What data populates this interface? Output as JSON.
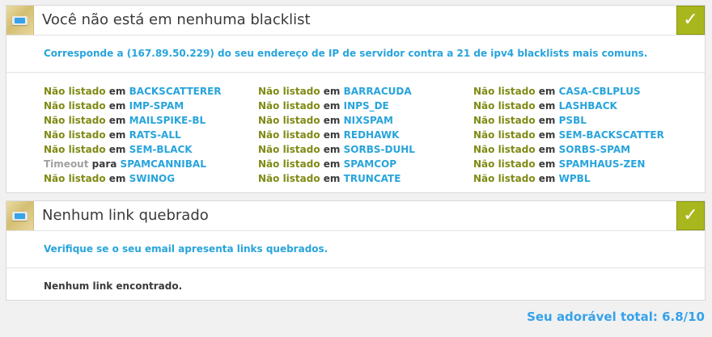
{
  "blacklist_panel": {
    "title": "Você não está em nenhuma blacklist",
    "description": "Corresponde a (167.89.50.229) do seu endereço de IP de servidor contra a 21 de ipv4 blacklists mais comuns.",
    "columns": [
      [
        {
          "status": "Não listado",
          "prep": "em",
          "name": "BACKSCATTERER",
          "status_type": "ok"
        },
        {
          "status": "Não listado",
          "prep": "em",
          "name": "IMP-SPAM",
          "status_type": "ok"
        },
        {
          "status": "Não listado",
          "prep": "em",
          "name": "MAILSPIKE-BL",
          "status_type": "ok"
        },
        {
          "status": "Não listado",
          "prep": "em",
          "name": "RATS-ALL",
          "status_type": "ok"
        },
        {
          "status": "Não listado",
          "prep": "em",
          "name": "SEM-BLACK",
          "status_type": "ok"
        },
        {
          "status": "Timeout",
          "prep": "para",
          "name": "SPAMCANNIBAL",
          "status_type": "timeout"
        },
        {
          "status": "Não listado",
          "prep": "em",
          "name": "SWINOG",
          "status_type": "ok"
        }
      ],
      [
        {
          "status": "Não listado",
          "prep": "em",
          "name": "BARRACUDA",
          "status_type": "ok"
        },
        {
          "status": "Não listado",
          "prep": "em",
          "name": "INPS_DE",
          "status_type": "ok"
        },
        {
          "status": "Não listado",
          "prep": "em",
          "name": "NIXSPAM",
          "status_type": "ok"
        },
        {
          "status": "Não listado",
          "prep": "em",
          "name": "REDHAWK",
          "status_type": "ok"
        },
        {
          "status": "Não listado",
          "prep": "em",
          "name": "SORBS-DUHL",
          "status_type": "ok"
        },
        {
          "status": "Não listado",
          "prep": "em",
          "name": "SPAMCOP",
          "status_type": "ok"
        },
        {
          "status": "Não listado",
          "prep": "em",
          "name": "TRUNCATE",
          "status_type": "ok"
        }
      ],
      [
        {
          "status": "Não listado",
          "prep": "em",
          "name": "CASA-CBLPLUS",
          "status_type": "ok"
        },
        {
          "status": "Não listado",
          "prep": "em",
          "name": "LASHBACK",
          "status_type": "ok"
        },
        {
          "status": "Não listado",
          "prep": "em",
          "name": "PSBL",
          "status_type": "ok"
        },
        {
          "status": "Não listado",
          "prep": "em",
          "name": "SEM-BACKSCATTER",
          "status_type": "ok"
        },
        {
          "status": "Não listado",
          "prep": "em",
          "name": "SORBS-SPAM",
          "status_type": "ok"
        },
        {
          "status": "Não listado",
          "prep": "em",
          "name": "SPAMHAUS-ZEN",
          "status_type": "ok"
        },
        {
          "status": "Não listado",
          "prep": "em",
          "name": "WPBL",
          "status_type": "ok"
        }
      ]
    ]
  },
  "links_panel": {
    "title": "Nenhum link quebrado",
    "description": "Verifique se o seu email apresenta links quebrados.",
    "result": "Nenhum link encontrado."
  },
  "score": "Seu adorável total: 6.8/10",
  "icons": {
    "panel_icon": "monitor-icon",
    "check_icon": "checkmark-icon",
    "check_glyph": "✓"
  },
  "colors": {
    "accent_blue": "#28a4dc",
    "ok_green": "#7f8a14",
    "check_bg": "#a9b71e",
    "timeout_gray": "#a0a0a0"
  }
}
